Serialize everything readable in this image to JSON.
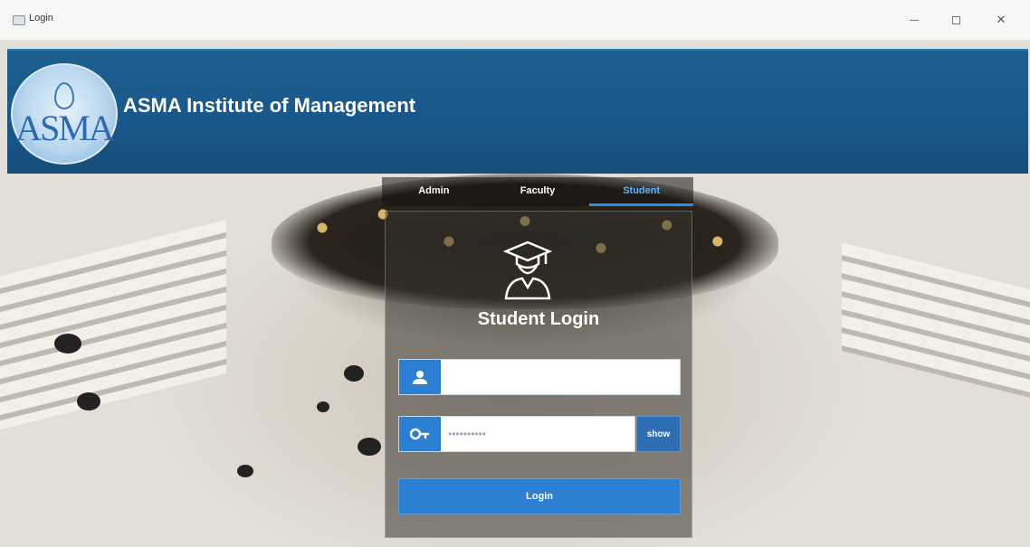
{
  "window": {
    "title": "Login"
  },
  "header": {
    "logo_text": "ASMA",
    "institute_name": "ASMA Institute of Management"
  },
  "tabs": [
    {
      "label": "Admin",
      "active": false
    },
    {
      "label": "Faculty",
      "active": false
    },
    {
      "label": "Student",
      "active": true
    }
  ],
  "login": {
    "title": "Student Login",
    "username_placeholder": "",
    "password_value": "••••••••••",
    "show_label": "show",
    "submit_label": "Login"
  },
  "icons": {
    "user": "user-icon",
    "key": "key-icon",
    "student": "graduate-icon"
  },
  "colors": {
    "banner": "#19578a",
    "accent": "#2d7fd3",
    "active_tab": "#5fb2ff"
  }
}
